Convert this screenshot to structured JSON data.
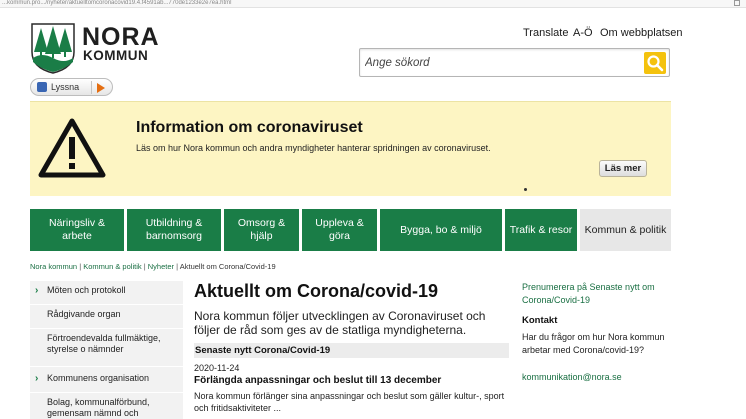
{
  "browser": {
    "url": "...kommun.pro.../nyheter/aktuelltomcoronacovid19.4.f4591ab...770de1233e2e7ea.html"
  },
  "header": {
    "logo_line1": "NORA",
    "logo_line2": "KOMMUN",
    "listen_label": "Lyssna",
    "links": [
      "Translate",
      "A-Ö",
      "Om webbplatsen"
    ],
    "search_placeholder": "Ange sökord"
  },
  "banner": {
    "title": "Information om coronaviruset",
    "text": "Läs om hur Nora kommun och andra myndigheter hanterar spridningen av coronaviruset.",
    "button": "Läs mer"
  },
  "nav": {
    "items": [
      {
        "label": "Näringsliv & arbete"
      },
      {
        "label": "Utbildning & barnomsorg"
      },
      {
        "label": "Omsorg & hjälp"
      },
      {
        "label": "Uppleva & göra"
      },
      {
        "label": "Bygga, bo & miljö"
      },
      {
        "label": "Trafik & resor"
      },
      {
        "label": "Kommun & politik"
      }
    ]
  },
  "breadcrumb": {
    "items": [
      "Nora kommun",
      "Kommun & politik",
      "Nyheter"
    ],
    "current": "Aktuellt om Corona/Covid-19"
  },
  "side_menu": {
    "items": [
      {
        "label": "Möten och protokoll"
      },
      {
        "label": "Rådgivande organ"
      },
      {
        "label": "Förtroendevalda fullmäktige, styrelse o nämnder"
      },
      {
        "label": "Kommunens organisation"
      },
      {
        "label": "Bolag, kommunalförbund, gemensam nämnd och"
      }
    ]
  },
  "main": {
    "title": "Aktuellt om Corona/covid-19",
    "lead": "Nora kommun följer utvecklingen av Coronaviruset och följer de råd som ges av de statliga myndigheterna.",
    "subhead": "Senaste nytt Corona/Covid-19",
    "news": {
      "date": "2020-11-24",
      "title": "Förlängda anpassningar och beslut till 13 december",
      "body": "Nora kommun förlänger sina anpassningar och beslut som gäller kultur-, sport och fritidsaktiviteter ..."
    }
  },
  "right": {
    "subscribe": "Prenumerera på Senaste nytt om Corona/Covid-19",
    "contact_heading": "Kontakt",
    "contact_text": "Har du frågor om hur Nora kommun arbetar med Corona/covid-19?",
    "contact_email": "kommunikation@nora.se"
  },
  "colors": {
    "green": "#1a7d47",
    "yellow": "#f4c20d",
    "banner_bg": "#fdf5c3",
    "link": "#1a6f43"
  }
}
